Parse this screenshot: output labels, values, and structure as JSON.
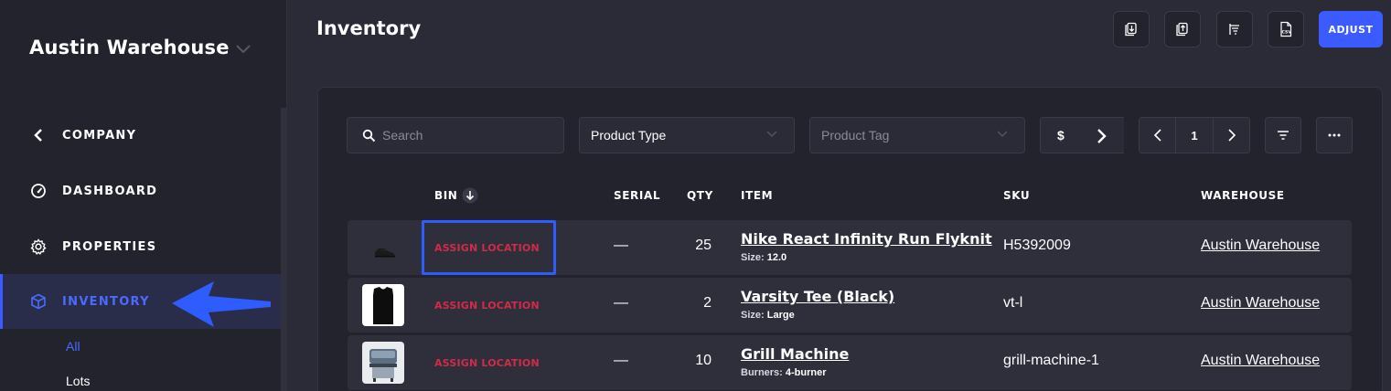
{
  "sidebar": {
    "warehouse_name": "Austin Warehouse",
    "items": [
      {
        "label": "COMPANY",
        "icon": "chevron-left-icon"
      },
      {
        "label": "DASHBOARD",
        "icon": "gauge-icon"
      },
      {
        "label": "PROPERTIES",
        "icon": "gear-icon"
      },
      {
        "label": "INVENTORY",
        "icon": "cube-icon",
        "active": true
      }
    ],
    "subitems": [
      {
        "label": "All",
        "active": true
      },
      {
        "label": "Lots"
      }
    ]
  },
  "header": {
    "title": "Inventory",
    "icon_buttons": [
      "import-icon",
      "export-icon",
      "list-sort-icon",
      "csv-icon"
    ],
    "adjust_label": "ADJUST"
  },
  "toolbar": {
    "search_placeholder": "Search",
    "product_type": "Product Type",
    "product_tag_placeholder": "Product Tag",
    "currency": "$",
    "page": "1"
  },
  "table": {
    "columns": {
      "bin": "BIN",
      "serial": "SERIAL",
      "qty": "QTY",
      "item": "ITEM",
      "sku": "SKU",
      "warehouse": "WAREHOUSE"
    },
    "rows": [
      {
        "bin": "ASSIGN LOCATION",
        "serial": "—",
        "qty": "25",
        "item": "Nike React Infinity Run Flyknit",
        "attr_key": "Size:",
        "attr_value": "12.0",
        "sku": "H5392009",
        "warehouse": "Austin Warehouse"
      },
      {
        "bin": "ASSIGN LOCATION",
        "serial": "—",
        "qty": "2",
        "item": "Varsity Tee (Black)",
        "attr_key": "Size:",
        "attr_value": "Large",
        "sku": "vt-l",
        "warehouse": "Austin Warehouse"
      },
      {
        "bin": "ASSIGN LOCATION",
        "serial": "—",
        "qty": "10",
        "item": "Grill Machine",
        "attr_key": "Burners:",
        "attr_value": "4-burner",
        "sku": "grill-machine-1",
        "warehouse": "Austin Warehouse"
      }
    ]
  },
  "colors": {
    "accent": "#3b5bff",
    "assign_location": "#d12b48",
    "background": "#2a2b36",
    "sidebar": "#22232d"
  }
}
